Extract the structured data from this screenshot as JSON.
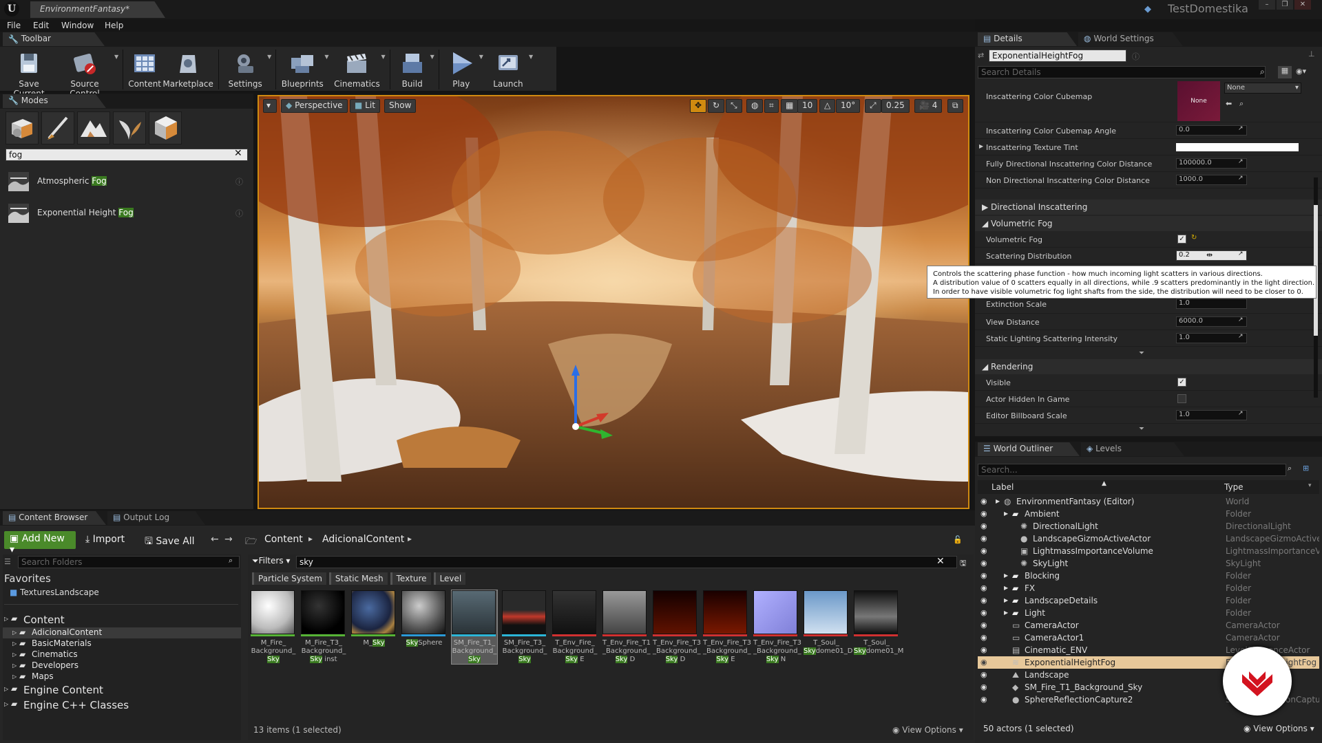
{
  "app": {
    "doc_tab": "EnvironmentFantasy*",
    "user": "TestDomestika",
    "window_buttons": [
      "–",
      "❐",
      "✕"
    ]
  },
  "menu": [
    "File",
    "Edit",
    "Window",
    "Help"
  ],
  "toolbar": {
    "tab": "Toolbar",
    "buttons": [
      {
        "label": "Save Current",
        "icon": "save-icon"
      },
      {
        "label": "Source Control",
        "icon": "source-control-icon"
      },
      {
        "label": "Content",
        "icon": "content-icon"
      },
      {
        "label": "Marketplace",
        "icon": "marketplace-icon"
      },
      {
        "label": "Settings",
        "icon": "settings-icon"
      },
      {
        "label": "Blueprints",
        "icon": "blueprints-icon"
      },
      {
        "label": "Cinematics",
        "icon": "cinematics-icon"
      },
      {
        "label": "Build",
        "icon": "build-icon"
      },
      {
        "label": "Play",
        "icon": "play-icon"
      },
      {
        "label": "Launch",
        "icon": "launch-icon"
      }
    ]
  },
  "modes": {
    "tab": "Modes",
    "search_value": "fog",
    "results": [
      {
        "prefix": "Atmospheric ",
        "match": "Fog"
      },
      {
        "prefix": "Exponential Height ",
        "match": "Fog"
      }
    ]
  },
  "viewport": {
    "perspective": "Perspective",
    "lit": "Lit",
    "show": "Show",
    "grid": "10",
    "rot": "10°",
    "scale": "0.25",
    "speed": "4"
  },
  "details": {
    "tab": "Details",
    "tab2": "World Settings",
    "actor_name": "ExponentialHeightFog",
    "search_placeholder": "Search Details",
    "cubemap_label": "Inscattering Color Cubemap",
    "cubemap_thumb": "None",
    "cubemap_select": "None",
    "rows": [
      {
        "label": "Inscattering Color Cubemap Angle",
        "value": "0.0"
      },
      {
        "label": "Inscattering Texture Tint",
        "value": ""
      },
      {
        "label": "Fully Directional Inscattering Color Distance",
        "value": "100000.0"
      },
      {
        "label": "Non Directional Inscattering Color Distance",
        "value": "1000.0"
      }
    ],
    "section_directional": "Directional Inscattering",
    "section_volumetric": "Volumetric Fog",
    "vol_rows": [
      {
        "label": "Volumetric Fog",
        "value": ""
      },
      {
        "label": "Scattering Distribution",
        "value": "0.2"
      },
      {
        "label": "Extinction Scale",
        "value": "1.0"
      },
      {
        "label": "View Distance",
        "value": "6000.0"
      },
      {
        "label": "Static Lighting Scattering Intensity",
        "value": "1.0"
      }
    ],
    "tooltip": [
      "Controls the scattering phase function - how much incoming light scatters in various directions.",
      "A distribution value of 0 scatters equally in all directions, while .9 scatters predominantly in the light direction.",
      "In order to have visible volumetric fog light shafts from the side, the distribution will need to be closer to 0."
    ],
    "section_rendering": "Rendering",
    "render_rows": [
      {
        "label": "Visible",
        "value": ""
      },
      {
        "label": "Actor Hidden In Game",
        "value": ""
      },
      {
        "label": "Editor Billboard Scale",
        "value": "1.0"
      }
    ]
  },
  "outliner": {
    "tab": "World Outliner",
    "tab2": "Levels",
    "search_placeholder": "Search...",
    "col_label": "Label",
    "col_type": "Type",
    "rows": [
      {
        "indent": 0,
        "label": "EnvironmentFantasy (Editor)",
        "type": "World",
        "kind": "world"
      },
      {
        "indent": 1,
        "label": "Ambient",
        "type": "Folder",
        "kind": "folder"
      },
      {
        "indent": 2,
        "label": "DirectionalLight",
        "type": "DirectionalLight",
        "kind": "light"
      },
      {
        "indent": 2,
        "label": "LandscapeGizmoActiveActor",
        "type": "LandscapeGizmoActiveA",
        "kind": "sphere"
      },
      {
        "indent": 2,
        "label": "LightmassImportanceVolume",
        "type": "LightmassImportanceVol",
        "kind": "box"
      },
      {
        "indent": 2,
        "label": "SkyLight",
        "type": "SkyLight",
        "kind": "light"
      },
      {
        "indent": 1,
        "label": "Blocking",
        "type": "Folder",
        "kind": "folder"
      },
      {
        "indent": 1,
        "label": "FX",
        "type": "Folder",
        "kind": "folder"
      },
      {
        "indent": 1,
        "label": "LandscapeDetails",
        "type": "Folder",
        "kind": "folder"
      },
      {
        "indent": 1,
        "label": "Light",
        "type": "Folder",
        "kind": "folder"
      },
      {
        "indent": 1,
        "label": "CameraActor",
        "type": "CameraActor",
        "kind": "camera"
      },
      {
        "indent": 1,
        "label": "CameraActor1",
        "type": "CameraActor",
        "kind": "camera"
      },
      {
        "indent": 1,
        "label": "Cinematic_ENV",
        "type": "LevelSequenceActor",
        "kind": "seq"
      },
      {
        "indent": 1,
        "label": "ExponentialHeightFog",
        "type": "ExponentialHeightFog",
        "kind": "fog",
        "selected": true
      },
      {
        "indent": 1,
        "label": "Landscape",
        "type": "",
        "kind": "land"
      },
      {
        "indent": 1,
        "label": "SM_Fire_T1_Background_Sky",
        "type": "",
        "kind": "mesh"
      },
      {
        "indent": 1,
        "label": "SphereReflectionCapture2",
        "type": "SphereReflectionCapture",
        "kind": "sphere"
      }
    ],
    "footer": "50 actors (1 selected)",
    "view_options": "View Options"
  },
  "content_browser": {
    "tab": "Content Browser",
    "tab2": "Output Log",
    "add_new": "Add New",
    "import": "Import",
    "save_all": "Save All",
    "path": [
      "Content",
      "AdicionalContent"
    ],
    "search_folders": "Search Folders",
    "favorites": "Favorites",
    "fav_item": "TexturesLandscape",
    "tree": [
      {
        "indent": 0,
        "label": "Content",
        "big": true
      },
      {
        "indent": 1,
        "label": "AdicionalContent",
        "selected": true
      },
      {
        "indent": 1,
        "label": "BasicMaterials"
      },
      {
        "indent": 1,
        "label": "Cinematics"
      },
      {
        "indent": 1,
        "label": "Developers"
      },
      {
        "indent": 1,
        "label": "Maps"
      },
      {
        "indent": 0,
        "label": "Engine Content",
        "big": true
      },
      {
        "indent": 0,
        "label": "Engine C++ Classes",
        "big": true
      }
    ],
    "filters": "Filters",
    "search_value": "sky",
    "filter_chips": [
      "Particle System",
      "Static Mesh",
      "Texture",
      "Level"
    ],
    "assets": [
      {
        "l1": "M_Fire_",
        "l2": "Background_",
        "l3": "Sky",
        "bar": "#56b435",
        "kind": "white"
      },
      {
        "l1": "M_Fire_T3_",
        "l2": "Background_",
        "l3": "Sky",
        "l4": " inst",
        "bar": "#56b435",
        "kind": "black"
      },
      {
        "l1": "M_Sky",
        "bar": "#56b435",
        "kind": "night"
      },
      {
        "l1": "SkySphere",
        "bar": "#2b9ad8",
        "kind": "grey"
      },
      {
        "l1": "SM_Fire_T1_",
        "l2": "Background_",
        "l3": "Sky",
        "bar": "#2bb6d8",
        "kind": "mesh",
        "selected": true
      },
      {
        "l1": "SM_Fire_T3_",
        "l2": "Background_",
        "l3": "Sky",
        "bar": "#2bb6d8",
        "kind": "bowl"
      },
      {
        "l1": "T_Env_Fire_",
        "l2": "Background_",
        "l3": "Sky",
        "l4": " E",
        "bar": "#d13030",
        "kind": "tex1"
      },
      {
        "l1": "T_Env_Fire_T1",
        "l2": "_Background_",
        "l3": "Sky",
        "l4": " D",
        "bar": "#d13030",
        "kind": "tex2"
      },
      {
        "l1": "T_Env_Fire_T3",
        "l2": "_Background_",
        "l3": "Sky",
        "l4": " D",
        "bar": "#d13030",
        "kind": "tex3"
      },
      {
        "l1": "T_Env_Fire_T3",
        "l2": "_Background_",
        "l3": "Sky",
        "l4": " E",
        "bar": "#d13030",
        "kind": "tex4"
      },
      {
        "l1": "T_Env_Fire_T3",
        "l2": "_Background_",
        "l3": "Sky",
        "l4": " N",
        "bar": "#d13030",
        "kind": "tex5"
      },
      {
        "l1": "T_Soul_",
        "l3": "Sky",
        "l5": "dome01_D",
        "bar": "#d13030",
        "kind": "tex6"
      },
      {
        "l1": "T_Soul_",
        "l3": "Sky",
        "l5": "dome01_M",
        "bar": "#d13030",
        "kind": "tex7"
      }
    ],
    "count": "13 items (1 selected)",
    "view_options": "View Options"
  },
  "colors": {
    "accent": "#d08a10",
    "highlight": "#3a7a20",
    "selection": "#e7c89a",
    "logo": "#d3131f"
  }
}
